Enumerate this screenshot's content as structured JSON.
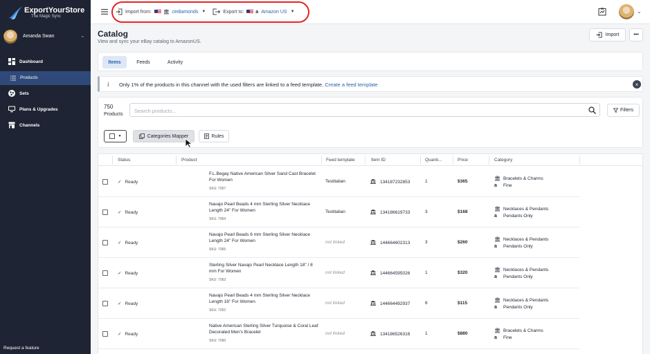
{
  "brand": {
    "name": "ExportYourStore",
    "tagline": "The Magic Sync"
  },
  "user": {
    "name": "Amanda Swan"
  },
  "sidebar": {
    "items": [
      {
        "label": "Dashboard",
        "icon": "dashboard-icon"
      },
      {
        "label": "Products",
        "icon": "list-icon",
        "active": true
      },
      {
        "label": "Sets",
        "icon": "sets-icon"
      },
      {
        "label": "Plans & Upgrades",
        "icon": "monitor-icon"
      },
      {
        "label": "Channels",
        "icon": "store-icon"
      }
    ],
    "request_feature": "Request a feature"
  },
  "topbar": {
    "import_label": "Import from:",
    "import_value": "cediamonds",
    "export_label": "Export to:",
    "export_value": "Amazon US"
  },
  "header": {
    "title": "Catalog",
    "subtitle": "View and sync your eBay catalog to AmazonUS.",
    "import_button": "Import",
    "more_button": "•••"
  },
  "tabs": [
    "Items",
    "Feeds",
    "Activity"
  ],
  "banner": {
    "text": "Only 1% of the products in this channel with the used filters are linked to a feed template.",
    "link": "Create a feed template"
  },
  "search": {
    "count": "750",
    "count_label": "Products",
    "placeholder": "Search products...",
    "filters_label": "Filters",
    "categories_mapper": "Categories Mapper",
    "rules": "Rules"
  },
  "table": {
    "columns": [
      "Status",
      "Product",
      "Feed template",
      "Item ID",
      "Quanti...",
      "Price",
      "Category"
    ],
    "rows": [
      {
        "status": "Ready",
        "name": "F.L.Begay Native American Silver Sand Cast Bracelet For Women",
        "sku": "SKU: 7067",
        "template": "Testitalian",
        "linked": true,
        "item_id": "134187232853",
        "qty": "1",
        "price": "$365",
        "cat1": "Bracelets & Charms",
        "cat2": "Fine"
      },
      {
        "status": "Ready",
        "name": "Navajo Pearl Beads 4 mm Sterling Silver Necklace Length 24\" For Women",
        "sku": "SKU: 7064",
        "template": "Testitalian",
        "linked": true,
        "item_id": "134186619733",
        "qty": "3",
        "price": "$168",
        "cat1": "Necklaces & Pendants",
        "cat2": "Pendants Only"
      },
      {
        "status": "Ready",
        "name": "Navajo Pearl Beads 6 mm Sterling Silver Necklace Length 24\" For Women",
        "sku": "SKU: 7065",
        "template": "not linked",
        "linked": false,
        "item_id": "144664602313",
        "qty": "3",
        "price": "$260",
        "cat1": "Necklaces & Pendants",
        "cat2": "Pendants Only"
      },
      {
        "status": "Ready",
        "name": "Sterling Silver Navajo Pearl Necklace Length 18\" / 8 mm For Women",
        "sku": "SKU: 7063",
        "template": "not linked",
        "linked": false,
        "item_id": "144664595026",
        "qty": "1",
        "price": "$320",
        "cat1": "Necklaces & Pendants",
        "cat2": "Pendants Only"
      },
      {
        "status": "Ready",
        "name": "Navajo Pearl Beads 4 mm Sterling Silver Necklace Length 16\" For Women",
        "sku": "SKU: 7062",
        "template": "not linked",
        "linked": false,
        "item_id": "144664492937",
        "qty": "6",
        "price": "$115",
        "cat1": "Necklaces & Pendants",
        "cat2": "Pendants Only"
      },
      {
        "status": "Ready",
        "name": "Native American Sterling Silver Turquoise & Coral Leaf Decorated Men's Bracelet",
        "sku": "SKU: 7060",
        "template": "not linked",
        "linked": false,
        "item_id": "134186526316",
        "qty": "1",
        "price": "$880",
        "cat1": "Bracelets & Charms",
        "cat2": "Fine"
      }
    ]
  },
  "colors": {
    "sidebar": "#1e2433",
    "accent": "#2563b0",
    "highlight": "#e52222"
  }
}
